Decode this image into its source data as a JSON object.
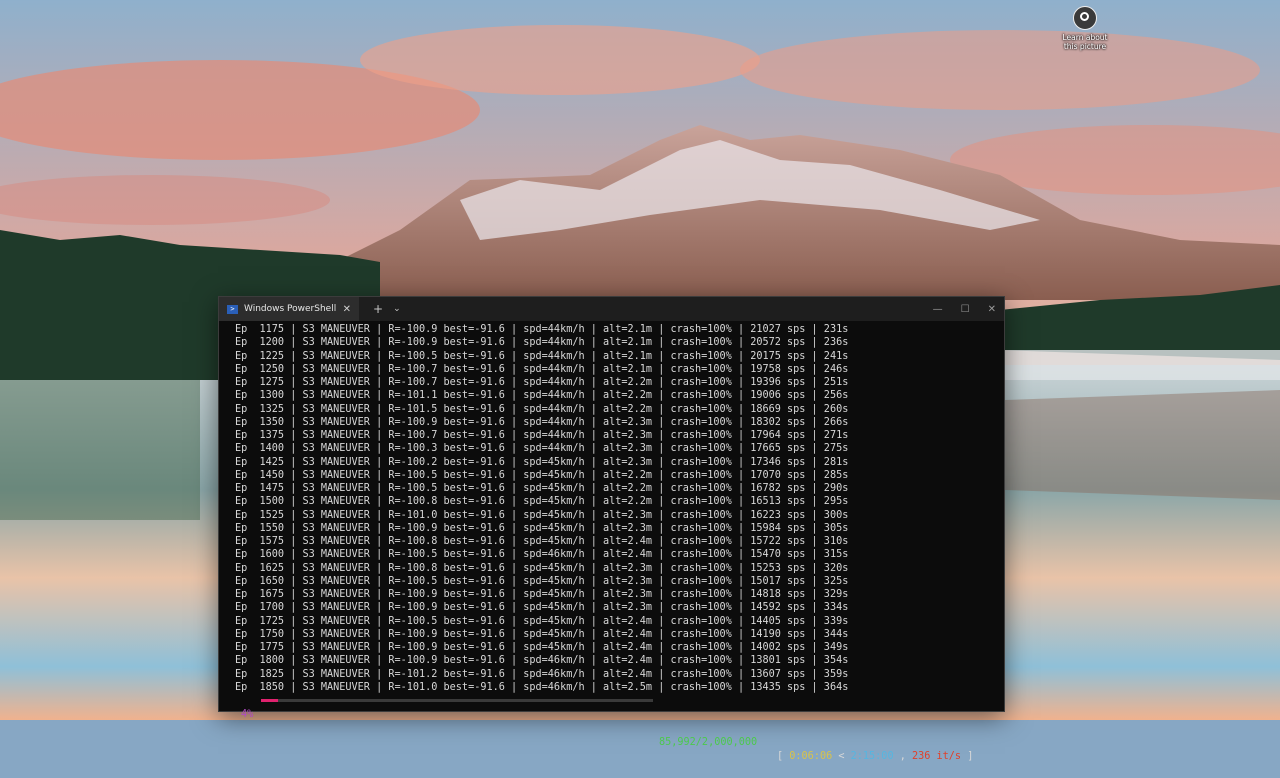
{
  "desktop": {
    "icon_label": "Learn about this picture"
  },
  "window": {
    "tab_title": "Windows PowerShell",
    "new_tab": "+",
    "dropdown": "⌄",
    "close_tab": "✕",
    "minimize": "—",
    "maximize": "☐",
    "close": "✕"
  },
  "terminal": {
    "lines": [
      "Ep  1175 | S3 MANEUVER | R=-100.9 best=-91.6 | spd=44km/h | alt=2.1m | crash=100% | 21027 sps | 231s",
      "Ep  1200 | S3 MANEUVER | R=-100.9 best=-91.6 | spd=44km/h | alt=2.1m | crash=100% | 20572 sps | 236s",
      "Ep  1225 | S3 MANEUVER | R=-100.5 best=-91.6 | spd=44km/h | alt=2.1m | crash=100% | 20175 sps | 241s",
      "Ep  1250 | S3 MANEUVER | R=-100.7 best=-91.6 | spd=44km/h | alt=2.1m | crash=100% | 19758 sps | 246s",
      "Ep  1275 | S3 MANEUVER | R=-100.7 best=-91.6 | spd=44km/h | alt=2.2m | crash=100% | 19396 sps | 251s",
      "Ep  1300 | S3 MANEUVER | R=-101.1 best=-91.6 | spd=44km/h | alt=2.2m | crash=100% | 19006 sps | 256s",
      "Ep  1325 | S3 MANEUVER | R=-101.5 best=-91.6 | spd=44km/h | alt=2.2m | crash=100% | 18669 sps | 260s",
      "Ep  1350 | S3 MANEUVER | R=-100.9 best=-91.6 | spd=44km/h | alt=2.3m | crash=100% | 18302 sps | 266s",
      "Ep  1375 | S3 MANEUVER | R=-100.7 best=-91.6 | spd=44km/h | alt=2.3m | crash=100% | 17964 sps | 271s",
      "Ep  1400 | S3 MANEUVER | R=-100.3 best=-91.6 | spd=44km/h | alt=2.3m | crash=100% | 17665 sps | 275s",
      "Ep  1425 | S3 MANEUVER | R=-100.2 best=-91.6 | spd=45km/h | alt=2.3m | crash=100% | 17346 sps | 281s",
      "Ep  1450 | S3 MANEUVER | R=-100.5 best=-91.6 | spd=45km/h | alt=2.2m | crash=100% | 17070 sps | 285s",
      "Ep  1475 | S3 MANEUVER | R=-100.5 best=-91.6 | spd=45km/h | alt=2.2m | crash=100% | 16782 sps | 290s",
      "Ep  1500 | S3 MANEUVER | R=-100.8 best=-91.6 | spd=45km/h | alt=2.2m | crash=100% | 16513 sps | 295s",
      "Ep  1525 | S3 MANEUVER | R=-101.0 best=-91.6 | spd=45km/h | alt=2.3m | crash=100% | 16223 sps | 300s",
      "Ep  1550 | S3 MANEUVER | R=-100.9 best=-91.6 | spd=45km/h | alt=2.3m | crash=100% | 15984 sps | 305s",
      "Ep  1575 | S3 MANEUVER | R=-100.8 best=-91.6 | spd=45km/h | alt=2.4m | crash=100% | 15722 sps | 310s",
      "Ep  1600 | S3 MANEUVER | R=-100.5 best=-91.6 | spd=46km/h | alt=2.4m | crash=100% | 15470 sps | 315s",
      "Ep  1625 | S3 MANEUVER | R=-100.8 best=-91.6 | spd=45km/h | alt=2.3m | crash=100% | 15253 sps | 320s",
      "Ep  1650 | S3 MANEUVER | R=-100.5 best=-91.6 | spd=45km/h | alt=2.3m | crash=100% | 15017 sps | 325s",
      "Ep  1675 | S3 MANEUVER | R=-100.9 best=-91.6 | spd=45km/h | alt=2.3m | crash=100% | 14818 sps | 329s",
      "Ep  1700 | S3 MANEUVER | R=-100.9 best=-91.6 | spd=45km/h | alt=2.3m | crash=100% | 14592 sps | 334s",
      "Ep  1725 | S3 MANEUVER | R=-100.5 best=-91.6 | spd=45km/h | alt=2.4m | crash=100% | 14405 sps | 339s",
      "Ep  1750 | S3 MANEUVER | R=-100.9 best=-91.6 | spd=45km/h | alt=2.4m | crash=100% | 14190 sps | 344s",
      "Ep  1775 | S3 MANEUVER | R=-100.9 best=-91.6 | spd=45km/h | alt=2.4m | crash=100% | 14002 sps | 349s",
      "Ep  1800 | S3 MANEUVER | R=-100.9 best=-91.6 | spd=46km/h | alt=2.4m | crash=100% | 13801 sps | 354s",
      "Ep  1825 | S3 MANEUVER | R=-101.2 best=-91.6 | spd=46km/h | alt=2.4m | crash=100% | 13607 sps | 359s",
      "Ep  1850 | S3 MANEUVER | R=-101.0 best=-91.6 | spd=46km/h | alt=2.5m | crash=100% | 13435 sps | 364s"
    ]
  },
  "progress": {
    "percent_label": "4%",
    "fraction": 0.043,
    "count": "85,992/2,000,000",
    "bracket_open": "[",
    "elapsed": "0:06:06",
    "separator": "<",
    "remaining": "2:15:00",
    "comma": ",",
    "rate": "236 it/s",
    "bracket_close": "]"
  },
  "colors": {
    "terminal_bg": "#0c0c0c",
    "percent": "#b04ac2",
    "bar_fill": "#e0226e",
    "count": "#4cc94c",
    "elapsed": "#d8c34a",
    "remaining": "#56b6e0",
    "rate": "#e0402a"
  }
}
